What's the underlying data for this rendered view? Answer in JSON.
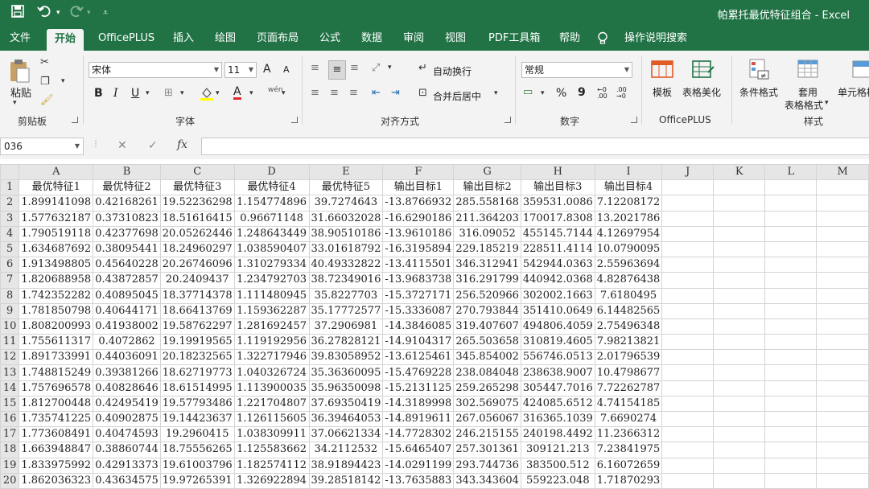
{
  "title_bar": {
    "title": "帕累托最优特征组合  -  Excel",
    "save_icon": "save-icon",
    "undo_icon": "undo-icon",
    "redo_icon": "redo-icon"
  },
  "tabs": [
    "文件",
    "开始",
    "OfficePLUS",
    "插入",
    "绘图",
    "页面布局",
    "公式",
    "数据",
    "审阅",
    "视图",
    "PDF工具箱",
    "帮助",
    "操作说明搜索"
  ],
  "active_tab": "开始",
  "ribbon": {
    "clipboard": {
      "paste_label": "粘贴",
      "group_label": "剪贴板"
    },
    "font": {
      "font_name": "宋体",
      "font_size": "11",
      "group_label": "字体",
      "bold": "B",
      "italic": "I",
      "underline": "U",
      "grow": "A",
      "shrink": "A",
      "font_color_glyph": "A",
      "phonetic": "wén"
    },
    "alignment": {
      "wrap_text": "自动换行",
      "merge_center": "合并后居中",
      "group_label": "对齐方式"
    },
    "number": {
      "format": "常规",
      "percent": "%",
      "comma": "9",
      "inc_decimal": "←0 .00",
      "dec_decimal": ".00 →0",
      "group_label": "数字"
    },
    "officeplus": {
      "template": "模板",
      "beautify": "表格美化",
      "group_label": "OfficePLUS"
    },
    "styles": {
      "conditional": "条件格式",
      "format_table_1": "套用",
      "format_table_2": "表格格式",
      "cell_styles": "单元格样式",
      "group_label": "样式"
    }
  },
  "formula_bar": {
    "name_box": "036",
    "fx": "fx",
    "formula": ""
  },
  "columns": [
    "A",
    "B",
    "C",
    "D",
    "E",
    "F",
    "G",
    "H",
    "I",
    "J",
    "K",
    "L",
    "M"
  ],
  "header_row": [
    "最优特征1",
    "最优特征2",
    "最优特征3",
    "最优特征4",
    "最优特征5",
    "输出目标1",
    "输出目标2",
    "输出目标3",
    "输出目标4"
  ],
  "rows": [
    [
      "1.899141098",
      "0.42168261",
      "19.52236298",
      "1.154774896",
      "39.7274643",
      "-13.8766932",
      "285.558168",
      "359531.0086",
      "7.12208172"
    ],
    [
      "1.577632187",
      "0.37310823",
      "18.51616415",
      "0.96671148",
      "31.66032028",
      "-16.6290186",
      "211.364203",
      "170017.8308",
      "13.2021786"
    ],
    [
      "1.790519118",
      "0.42377698",
      "20.05262446",
      "1.248643449",
      "38.90510186",
      "-13.9610186",
      "316.09052",
      "455145.7144",
      "4.12697954"
    ],
    [
      "1.634687692",
      "0.38095441",
      "18.24960297",
      "1.038590407",
      "33.01618792",
      "-16.3195894",
      "229.185219",
      "228511.4114",
      "10.0790095"
    ],
    [
      "1.913498805",
      "0.45640228",
      "20.26746096",
      "1.310279334",
      "40.49332822",
      "-13.4115501",
      "346.312941",
      "542944.0363",
      "2.55963694"
    ],
    [
      "1.820688958",
      "0.43872857",
      "20.2409437",
      "1.234792703",
      "38.72349016",
      "-13.9683738",
      "316.291799",
      "440942.0368",
      "4.82876438"
    ],
    [
      "1.742352282",
      "0.40895045",
      "18.37714378",
      "1.111480945",
      "35.8227703",
      "-15.3727171",
      "256.520966",
      "302002.1663",
      "7.6180495"
    ],
    [
      "1.781850798",
      "0.40644171",
      "18.66413769",
      "1.159362287",
      "35.17772577",
      "-15.3336087",
      "270.793844",
      "351410.0649",
      "6.14482565"
    ],
    [
      "1.808200993",
      "0.41938002",
      "19.58762297",
      "1.281692457",
      "37.2906981",
      "-14.3846085",
      "319.407607",
      "494806.4059",
      "2.75496348"
    ],
    [
      "1.755611317",
      "0.4072862",
      "19.19919565",
      "1.119192956",
      "36.27828121",
      "-14.9104317",
      "265.503658",
      "310819.4605",
      "7.98213821"
    ],
    [
      "1.891733991",
      "0.44036091",
      "20.18232565",
      "1.322717946",
      "39.83058952",
      "-13.6125461",
      "345.854002",
      "556746.0513",
      "2.01796539"
    ],
    [
      "1.748815249",
      "0.39381266",
      "18.62719773",
      "1.040326724",
      "35.36360095",
      "-15.4769228",
      "238.084048",
      "238638.9007",
      "10.4798677"
    ],
    [
      "1.757696578",
      "0.40828646",
      "18.61514995",
      "1.113900035",
      "35.96350098",
      "-15.2131125",
      "259.265298",
      "305447.7016",
      "7.72262787"
    ],
    [
      "1.812700448",
      "0.42495419",
      "19.57793486",
      "1.221704807",
      "37.69350419",
      "-14.3189998",
      "302.569075",
      "424085.6512",
      "4.74154185"
    ],
    [
      "1.735741225",
      "0.40902875",
      "19.14423637",
      "1.126115605",
      "36.39464053",
      "-14.8919611",
      "267.056067",
      "316365.1039",
      "7.6690274"
    ],
    [
      "1.773608491",
      "0.40474593",
      "19.2960415",
      "1.038309911",
      "37.06621334",
      "-14.7728302",
      "246.215155",
      "240198.4492",
      "11.2366312"
    ],
    [
      "1.663948847",
      "0.38860744",
      "18.75556265",
      "1.125583662",
      "34.2112532",
      "-15.6465407",
      "257.301361",
      "309121.213",
      "7.23841975"
    ],
    [
      "1.833975992",
      "0.42913373",
      "19.61003796",
      "1.182574112",
      "38.91894423",
      "-14.0291199",
      "293.744736",
      "383500.512",
      "6.16072659"
    ],
    [
      "1.862036323",
      "0.43634575",
      "19.97265391",
      "1.326922894",
      "39.28518142",
      "-13.7635883",
      "343.343604",
      "559223.048",
      "1.71870293"
    ]
  ],
  "colors": {
    "excel_green": "#217346",
    "ribbon_bg": "#f3f3f3",
    "grid_line": "#d4d4d4",
    "header_bg": "#e6e6e6"
  }
}
